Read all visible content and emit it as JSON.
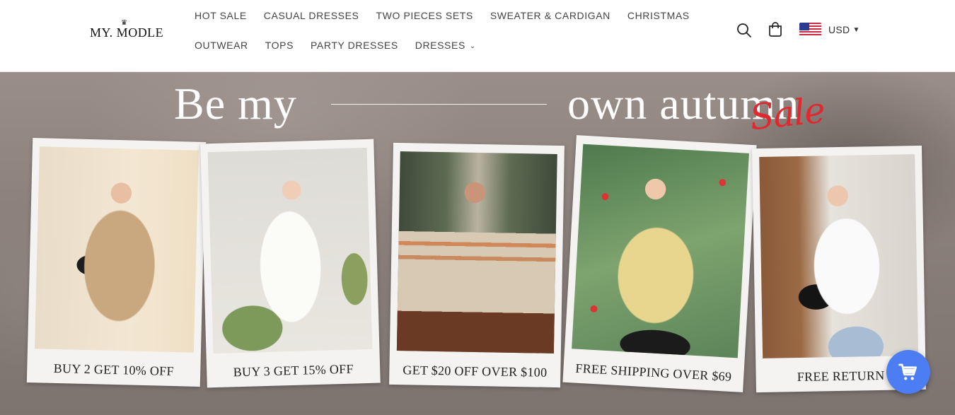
{
  "brand": {
    "name": "MY. MODLE"
  },
  "nav": {
    "row1": [
      "HOT SALE",
      "CASUAL DRESSES",
      "TWO PIECES SETS",
      "SWEATER & CARDIGAN",
      "CHRISTMAS"
    ],
    "row2": [
      "OUTWEAR",
      "TOPS",
      "PARTY DRESSES",
      "DRESSES"
    ]
  },
  "header": {
    "search_icon": "search-icon",
    "cart_icon": "cart-icon",
    "currency": {
      "label": "USD",
      "flag": "us-flag-icon"
    }
  },
  "banner": {
    "headline_left": "Be my",
    "headline_right": "own autumn",
    "script": "Sale",
    "cards": [
      {
        "caption": "BUY 2 GET 10% OFF"
      },
      {
        "caption": "BUY 3 GET 15% OFF"
      },
      {
        "caption": "GET $20 OFF OVER $100"
      },
      {
        "caption": "FREE SHIPPING OVER $69"
      },
      {
        "caption": "FREE RETURN"
      }
    ]
  },
  "chat": {
    "icon": "cart-chat-icon"
  },
  "colors": {
    "accent": "#4d7df2",
    "sale_red": "#e0282e"
  }
}
